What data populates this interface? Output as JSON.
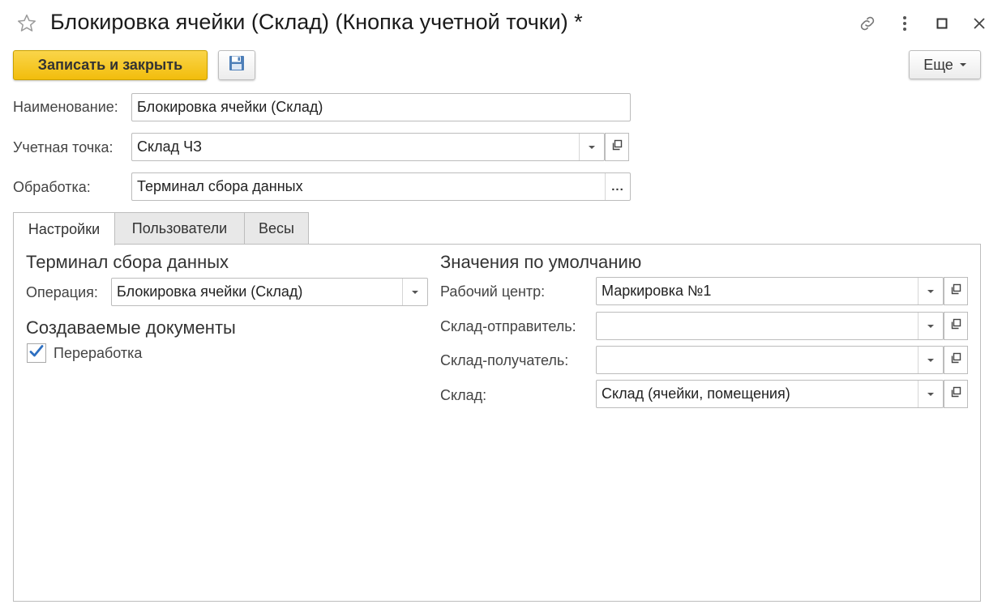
{
  "window": {
    "title": "Блокировка ячейки (Склад) (Кнопка учетной точки) *",
    "icons": [
      "star-icon",
      "link-icon",
      "more-vertical-icon",
      "maximize-icon",
      "close-icon"
    ]
  },
  "toolbar": {
    "save_close_label": "Записать и закрыть",
    "save_icon": "floppy-disk-icon",
    "more_label": "Еще"
  },
  "form": {
    "name_label": "Наименование:",
    "name_value": "Блокировка ячейки (Склад)",
    "point_label": "Учетная точка:",
    "point_value": "Склад ЧЗ",
    "processing_label": "Обработка:",
    "processing_value": "Терминал сбора данных",
    "processing_button": "..."
  },
  "tabs": [
    {
      "label": "Настройки",
      "active": true
    },
    {
      "label": "Пользователи",
      "active": false
    },
    {
      "label": "Весы",
      "active": false
    }
  ],
  "settings": {
    "terminal_title": "Терминал сбора данных",
    "operation_label": "Операция:",
    "operation_value": "Блокировка ячейки (Склад)",
    "docs_title": "Создаваемые документы",
    "rework_label": "Переработка",
    "rework_checked": true,
    "defaults_title": "Значения по умолчанию",
    "workcenter_label": "Рабочий центр:",
    "workcenter_value": "Маркировка №1",
    "sender_label": "Склад-отправитель:",
    "sender_value": "",
    "receiver_label": "Склад-получатель:",
    "receiver_value": "",
    "warehouse_label": "Склад:",
    "warehouse_value": "Склад (ячейки, помещения)"
  },
  "colors": {
    "primary_button": "#f2bd0c",
    "check_mark": "#2d6fc1",
    "border": "#bcbcbc"
  }
}
